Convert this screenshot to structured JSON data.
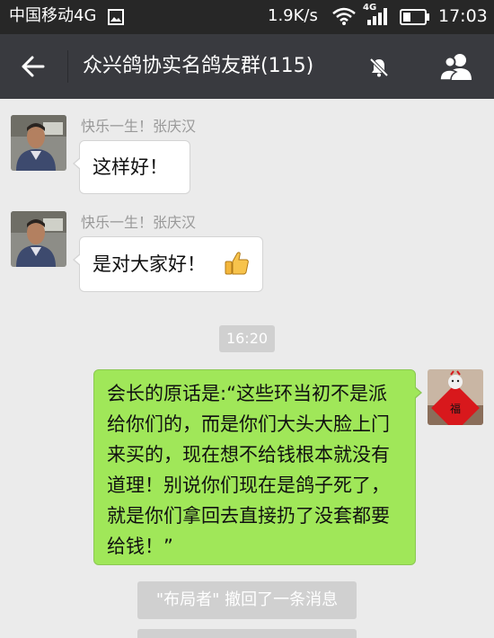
{
  "status_bar": {
    "carrier": "中国移动4G",
    "net_speed": "1.9K/s",
    "network_type": "4G",
    "time": "17:03"
  },
  "header": {
    "title": "众兴鸽协实名鸽友群(115)",
    "back_icon": "arrow-left-icon",
    "mute_icon": "bell-off-icon",
    "members_icon": "group-people-icon"
  },
  "messages": [
    {
      "sender": "快乐一生！张庆汉",
      "text": "这样好！",
      "side": "left"
    },
    {
      "sender": "快乐一生！张庆汉",
      "text": "是对大家好！",
      "emoji": "thumbs-up-icon",
      "side": "left"
    },
    {
      "text": "会长的原话是:“这些环当初不是派给你们的，而是你们大头大脸上门来买的，现在想不给钱根本就没有道理！别说你们现在是鸽子死了，就是你们拿回去直接扔了没套都要给钱！”",
      "side": "right"
    }
  ],
  "timestamp": "16:20",
  "system_notice": "\"布局者\" 撤回了一条消息",
  "colors": {
    "status_bar_bg": "#272727",
    "header_bg": "#393a3f",
    "chat_bg": "#ebebeb",
    "outgoing_bubble": "#a0e759",
    "incoming_bubble": "#ffffff"
  }
}
